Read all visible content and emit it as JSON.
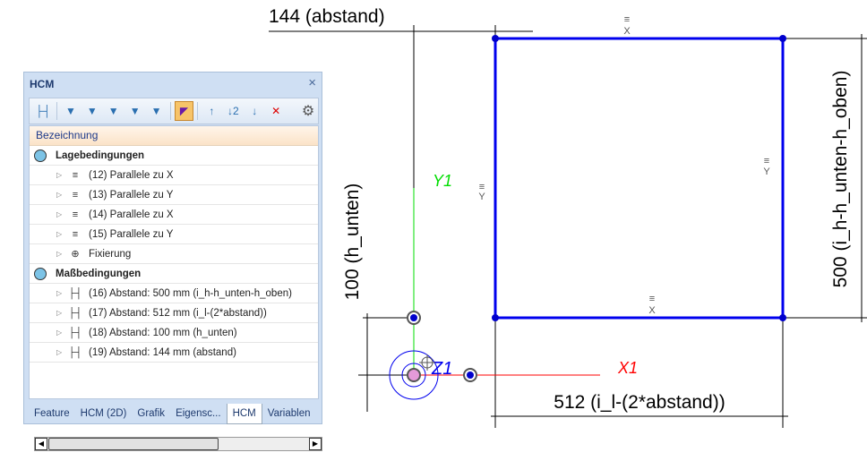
{
  "panel": {
    "title": "HCM",
    "close": "×",
    "header": "Bezeichnung",
    "groups": [
      {
        "label": "Lagebedingungen",
        "items": [
          {
            "label": "(12) Parallele zu X",
            "icon": "parallel-x-icon"
          },
          {
            "label": "(13) Parallele zu Y",
            "icon": "parallel-y-icon"
          },
          {
            "label": "(14) Parallele zu X",
            "icon": "parallel-x-icon"
          },
          {
            "label": "(15) Parallele zu Y",
            "icon": "parallel-y-icon"
          },
          {
            "label": "Fixierung",
            "icon": "fixation-icon"
          }
        ]
      },
      {
        "label": "Maßbedingungen",
        "items": [
          {
            "label": "(16) Abstand: 500 mm (i_h-h_unten-h_oben)",
            "icon": "distance-icon"
          },
          {
            "label": "(17) Abstand: 512 mm (i_l-(2*abstand))",
            "icon": "distance-icon"
          },
          {
            "label": "(18) Abstand: 100 mm (h_unten)",
            "icon": "distance-icon"
          },
          {
            "label": "(19) Abstand: 144 mm (abstand)",
            "icon": "distance-icon"
          }
        ]
      }
    ],
    "tabs": [
      "Feature",
      "HCM (2D)",
      "Grafik",
      "Eigensc...",
      "HCM",
      "Variablen"
    ],
    "active_tab": "HCM"
  },
  "drawing": {
    "dim_top": "144 (abstand)",
    "dim_left": "100 (h_unten)",
    "dim_right": "500 (i_h-h_unten-h_oben)",
    "dim_bottom": "512 (i_l-(2*abstand))",
    "axis_x": "X1",
    "axis_y": "Y1",
    "axis_z": "Z1",
    "sym_x": "X",
    "sym_y": "Y",
    "colors": {
      "sketch": "#0000ee",
      "x_axis": "#ff0000",
      "y_axis": "#00dd00"
    }
  }
}
